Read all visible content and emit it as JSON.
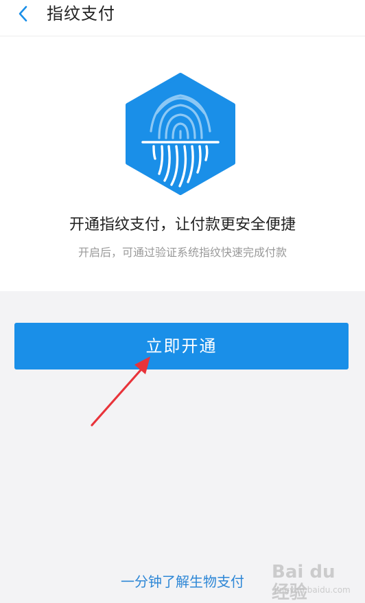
{
  "header": {
    "back_icon": "chevron-left-icon",
    "title": "指纹支付"
  },
  "hero": {
    "icon": "fingerprint-hexagon-icon",
    "headline": "开通指纹支付，让付款更安全便捷",
    "subline": "开启后，可通过验证系统指纹快速完成付款"
  },
  "actions": {
    "open_label": "立即开通"
  },
  "footer": {
    "learn_link": "一分钟了解生物支付"
  },
  "watermark": {
    "main": "Bai du 经验",
    "sub": "jingyan.baidu.com"
  },
  "colors": {
    "accent": "#1a8fe8",
    "link": "#2e87d6",
    "annotation_arrow": "#e8333a"
  }
}
